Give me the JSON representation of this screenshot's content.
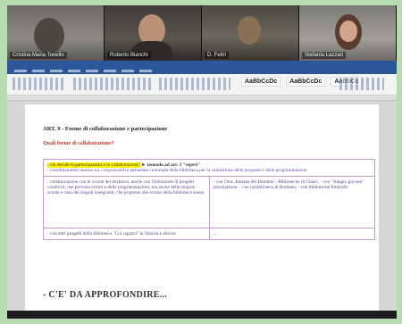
{
  "video": {
    "participants": [
      {
        "name": "Cristina Maria Tonello"
      },
      {
        "name": "Roberto Bianchi"
      },
      {
        "name": "D. Feltri"
      },
      {
        "name": "Stefania Lazzari"
      }
    ]
  },
  "ribbon": {
    "styles": [
      "AaBbCcDc",
      "AaBbCcDc",
      "AaBbCc"
    ]
  },
  "document": {
    "heading": "ART. 9 - Forme di collaborazione e partecipazione",
    "subheading": "Quali forme di collaborazione?",
    "table": {
      "r1": {
        "highlight": "- chi decide le partecipazioni e le collaborazioni?",
        "after": " ► tenendo ad art. 3 \"reperi\"",
        "line2": "- coordinamento interno tra i responsabili e personale comunale della biblioteca per la valutazione delle proposte e delle programmazioni"
      },
      "r2c1": "- collaborazione con le scuole del territorio, anche con l'istituzione di progetti condivisi, che prevono eventi e delle programmazioni, ma anche della singole scuola e caso dei singoli insegnanti, che proposte alle scuole della biblioteca stessa",
      "r2c2": "- con l'Ass. Italiana dei Bambini - Biblioteche di Chiari; - con \"Adagio giovani\" associazione; - con la biblioteca di Rudiano; - con biblioteche limitrofe",
      "r3c1": "- con altri progetti della biblioteca \"Coi ragazzi\" in libreria e altrove",
      "r3c2": "..."
    },
    "footer_heading": "- C'E' DA APPROFONDIRE..."
  }
}
